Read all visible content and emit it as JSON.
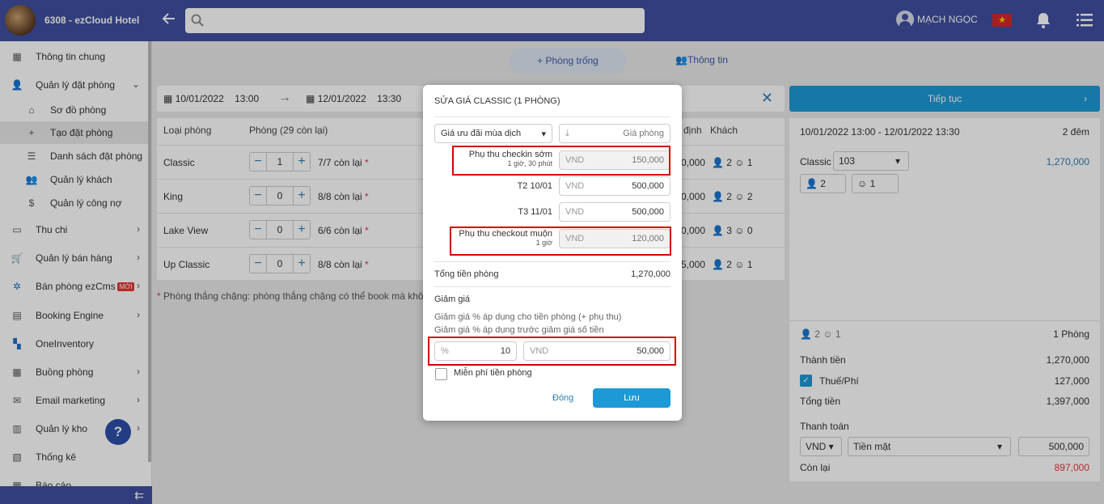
{
  "header": {
    "hotel_name": "6308 - ezCloud Hotel",
    "user_name": "MẠCH NGỌC",
    "flag_star": "★"
  },
  "sidebar": {
    "items": [
      {
        "label": "Thông tin chung"
      },
      {
        "label": "Quản lý đặt phòng"
      },
      {
        "label": "Sơ đồ phòng"
      },
      {
        "label": "Tạo đặt phòng"
      },
      {
        "label": "Danh sách đặt phòng"
      },
      {
        "label": "Quản lý khách"
      },
      {
        "label": "Quản lý công nợ"
      },
      {
        "label": "Thu chi"
      },
      {
        "label": "Quản lý bán hàng"
      },
      {
        "label": "Bán phòng ezCms"
      },
      {
        "label": "Booking Engine"
      },
      {
        "label": "OneInventory"
      },
      {
        "label": "Buồng phòng"
      },
      {
        "label": "Email marketing"
      },
      {
        "label": "Quản lý kho"
      },
      {
        "label": "Thống kê"
      },
      {
        "label": "Báo cáo"
      }
    ],
    "new_badge": "MỚI",
    "help": "?"
  },
  "tabs": {
    "empty_rooms": "Phòng trống",
    "info": "Thông tin"
  },
  "datebar": {
    "from_date": "10/01/2022",
    "from_time": "13:00",
    "to_date": "12/01/2022",
    "to_time": "13:30"
  },
  "rooms_table": {
    "col_type": "Loại phòng",
    "col_rooms": "Phòng (29 còn lại)",
    "col_rate": "định",
    "col_guests": "Khách",
    "rows": [
      {
        "name": "Classic",
        "qty": "1",
        "avail": "7/7 còn lại",
        "price": "0,000",
        "adults": "2",
        "kids": "1"
      },
      {
        "name": "King",
        "qty": "0",
        "avail": "8/8 còn lại",
        "price": "0,000",
        "adults": "2",
        "kids": "2"
      },
      {
        "name": "Lake View",
        "qty": "0",
        "avail": "6/6 còn lại",
        "price": "0,000",
        "adults": "3",
        "kids": "0"
      },
      {
        "name": "Up Classic",
        "qty": "0",
        "avail": "8/8 còn lại",
        "price": "5,000",
        "adults": "2",
        "kids": "1"
      }
    ],
    "asterisk": "*",
    "note": "Phòng thắng chặng: phòng thắng chặng có thể book mà không p"
  },
  "summary": {
    "continue": "Tiếp tục",
    "range": "10/01/2022 13:00 - 12/01/2022 13:30",
    "nights": "2 đêm",
    "room_type": "Classic",
    "room_no": "103",
    "room_price": "1,270,000",
    "adults": "2",
    "kids": "1",
    "guest_adults": "2",
    "guest_kids": "1",
    "rooms_count": "1 Phòng",
    "subtotal_label": "Thành tiền",
    "subtotal": "1,270,000",
    "tax_label": "Thuế/Phí",
    "tax": "127,000",
    "total_label": "Tổng tiền",
    "total": "1,397,000",
    "payment_label": "Thanh toán",
    "currency": "VND",
    "method": "Tiền mặt",
    "paid": "500,000",
    "remaining_label": "Còn lại",
    "remaining": "897,000",
    "remaining_color": "#e53935"
  },
  "modal": {
    "title": "SỬA GIÁ CLASSIC (1 PHÒNG)",
    "season": "Giá ưu đãi mùa dịch",
    "price_placeholder": "Giá phòng",
    "currency": "VND",
    "lines": [
      {
        "label": "Phụ thu checkin sớm",
        "sub": "1 giờ, 30 phút",
        "value": "150,000"
      },
      {
        "label": "T2 10/01",
        "sub": "",
        "value": "500,000"
      },
      {
        "label": "T3 11/01",
        "sub": "",
        "value": "500,000"
      },
      {
        "label": "Phụ thu checkout muộn",
        "sub": "1 giờ",
        "value": "120,000"
      }
    ],
    "total_label": "Tổng tiền phòng",
    "total": "1,270,000",
    "discount_title": "Giảm giá",
    "discount_note1": "Giảm giá % áp dụng cho tiền phòng (+ phụ thu)",
    "discount_note2": "Giảm giá % áp dụng trước giảm giá số tiền",
    "pct_prefix": "%",
    "pct_value": "10",
    "amount_value": "50,000",
    "free_label": "Miễn phí tiền phòng",
    "close": "Đóng",
    "save": "Lưu"
  }
}
